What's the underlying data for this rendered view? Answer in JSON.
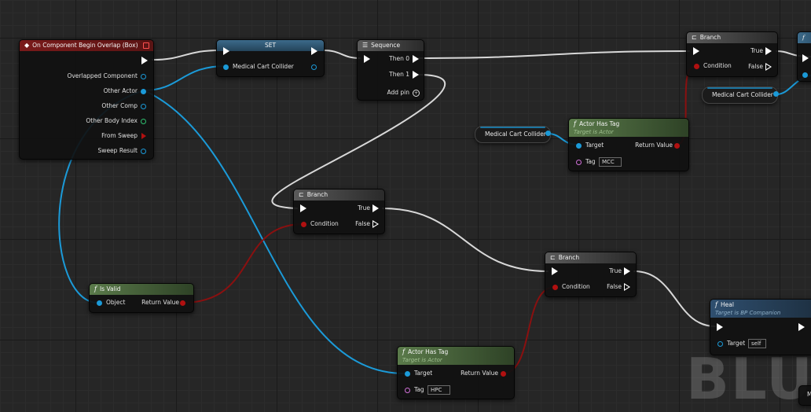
{
  "nodes": {
    "on_overlap": {
      "title": "On Component Begin Overlap (Box)",
      "pins": [
        "Overlapped Component",
        "Other Actor",
        "Other Comp",
        "Other Body Index",
        "From Sweep",
        "Sweep Result"
      ]
    },
    "set": {
      "title": "SET",
      "input": "Medical Cart Collider"
    },
    "sequence": {
      "title": "Sequence",
      "then0": "Then 0",
      "then1": "Then 1",
      "add_pin": "Add pin"
    },
    "branch_top": {
      "title": "Branch",
      "true": "True",
      "false": "False",
      "condition": "Condition"
    },
    "getter_top": {
      "label": "Medical Cart Collider"
    },
    "getter_mid": {
      "label": "Medical Cart Collider"
    },
    "has_tag_1": {
      "title": "Actor Has Tag",
      "subtitle": "Target is Actor",
      "target": "Target",
      "return": "Return Value",
      "tag_label": "Tag",
      "tag_value": "MCC"
    },
    "branch_mid": {
      "title": "Branch",
      "true": "True",
      "false": "False",
      "condition": "Condition"
    },
    "branch_low": {
      "title": "Branch",
      "true": "True",
      "false": "False",
      "condition": "Condition"
    },
    "is_valid": {
      "title": "Is Valid",
      "object": "Object",
      "return": "Return Value"
    },
    "heal": {
      "title": "Heal",
      "subtitle": "Target is BP Companion",
      "target": "Target",
      "target_value": "self"
    },
    "has_tag_2": {
      "title": "Actor Has Tag",
      "subtitle": "Target is Actor",
      "target": "Target",
      "return": "Return Value",
      "tag_label": "Tag",
      "tag_value": "HPC"
    },
    "partial_right": {
      "icon": "f",
      "bottom_label": "M"
    }
  },
  "watermark": "BLUE",
  "colors": {
    "exec": "#ffffff",
    "object_pin": "#1b9ad8",
    "bool_pin": "#b01010",
    "int_pin": "#2fbf6f",
    "name_pin": "#d070d8",
    "event_header": "#7a1a1a",
    "pure_fn_header": "#5a7a4a",
    "flow_header": "#5a5a5a",
    "variable_header": "#3c6a8a"
  },
  "icons": {
    "event": "event-diamond-icon",
    "function": "function-f-icon",
    "branch": "branch-icon",
    "sequence": "sequence-icon",
    "add_pin": "plus-circle-icon"
  }
}
